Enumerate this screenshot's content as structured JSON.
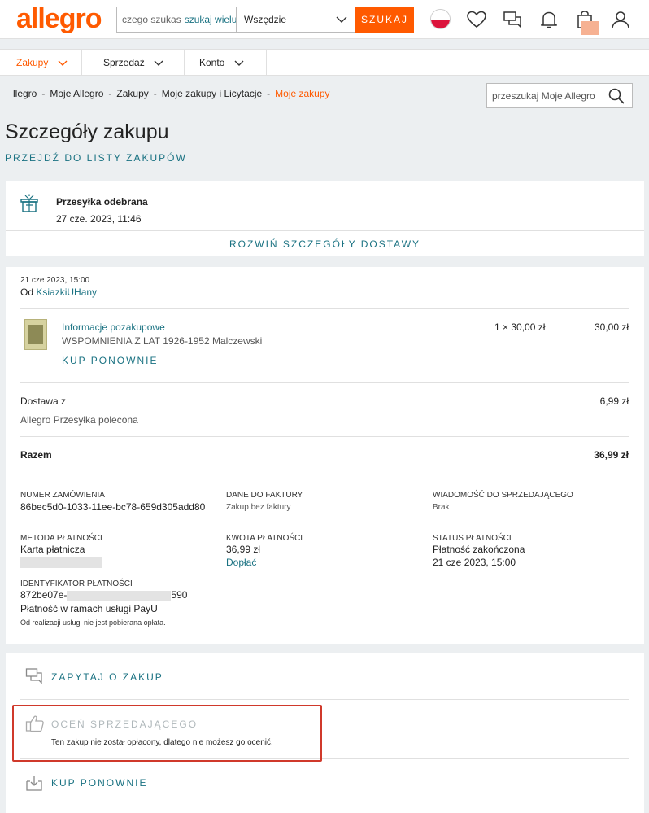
{
  "header": {
    "logo": "allegro",
    "search_placeholder": "czego szukas",
    "search_multi": "szukaj wielu",
    "scope": "Wszędzie",
    "search_button": "SZUKAJ",
    "colors": {
      "brand": "#ff5a00",
      "teal": "#1a7282"
    }
  },
  "menu": [
    {
      "label": "Zakupy"
    },
    {
      "label": "Sprzedaż"
    },
    {
      "label": "Konto"
    }
  ],
  "breadcrumb": [
    "llegro",
    "Moje Allegro",
    "Zakupy",
    "Moje zakupy i Licytacje",
    "Moje zakupy"
  ],
  "my_search_placeholder": "przeszukaj Moje Allegro",
  "page_title": "Szczegóły zakupu",
  "back_link": "PRZEJDŹ DO LISTY ZAKUPÓW",
  "shipment": {
    "status": "Przesyłka odebrana",
    "date": "27 cze. 2023, 11:46",
    "expand": "ROZWIŃ SZCZEGÓŁY DOSTAWY"
  },
  "order": {
    "date": "21 cze 2023, 15:00",
    "from_label": "Od",
    "seller": "KsiazkiUHany",
    "item": {
      "link": "Informacje pozakupowe",
      "title": "WSPOMNIENIA Z LAT 1926-1952 Malczewski",
      "qty_price": "1 × 30,00 zł",
      "total": "30,00 zł",
      "buy_again": "KUP PONOWNIE"
    },
    "delivery_label": "Dostawa z",
    "delivery_method": "Allegro Przesyłka polecona",
    "delivery_price": "6,99 zł",
    "sum_label": "Razem",
    "sum_value": "36,99 zł",
    "info": {
      "order_no_label": "NUMER ZAMÓWIENIA",
      "order_no": "86bec5d0-1033-11ee-bc78-659d305add80",
      "invoice_label": "DANE DO FAKTURY",
      "invoice": "Zakup bez faktury",
      "message_label": "WIADOMOŚĆ DO SPRZEDAJĄCEGO",
      "message": "Brak",
      "payment_method_label": "METODA PŁATNOŚCI",
      "payment_method": "Karta płatnicza",
      "amount_label": "KWOTA PŁATNOŚCI",
      "amount": "36,99 zł",
      "pay_more": "Dopłać",
      "payment_status_label": "STATUS PŁATNOŚCI",
      "payment_status": "Płatność zakończona",
      "payment_status_date": "21 cze 2023, 15:00",
      "payment_id_label": "IDENTYFIKATOR PŁATNOŚCI",
      "payment_id_start": "872be07e-",
      "payment_id_end": "590",
      "payu": "Płatność w ramach usługi PayU",
      "payu_note": "Od realizacji usługi nie jest pobierana opłata."
    }
  },
  "actions": {
    "ask": "ZAPYTAJ O ZAKUP",
    "rate": "OCEŃ SPRZEDAJĄCEGO",
    "rate_note": "Ten zakup nie został opłacony, dlatego nie możesz go ocenić.",
    "buy_again": "KUP PONOWNIE"
  }
}
